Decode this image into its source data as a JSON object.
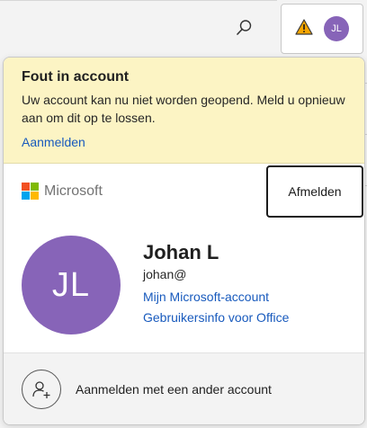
{
  "toolbar": {
    "search_icon": "search-icon",
    "account_warning_icon": "warning-icon",
    "mini_avatar_initials": "JL"
  },
  "error": {
    "title": "Fout in account",
    "message": "Uw account kan nu niet worden geopend. Meld u opnieuw aan om dit op te lossen.",
    "signin_label": "Aanmelden"
  },
  "header": {
    "brand": "Microsoft",
    "signout_label": "Afmelden"
  },
  "user": {
    "initials": "JL",
    "name": "Johan L",
    "email": "johan@",
    "link_account": "Mijn Microsoft-account",
    "link_office": "Gebruikersinfo voor Office"
  },
  "footer": {
    "switch_account_label": "Aanmelden met een ander account"
  },
  "colors": {
    "avatar": "#8764b8",
    "link": "#185abd",
    "error_bg": "#fcf4c4",
    "warning": "#f7a600",
    "ms_red": "#f25022",
    "ms_green": "#7fba00",
    "ms_blue": "#00a4ef",
    "ms_yellow": "#ffb900"
  }
}
